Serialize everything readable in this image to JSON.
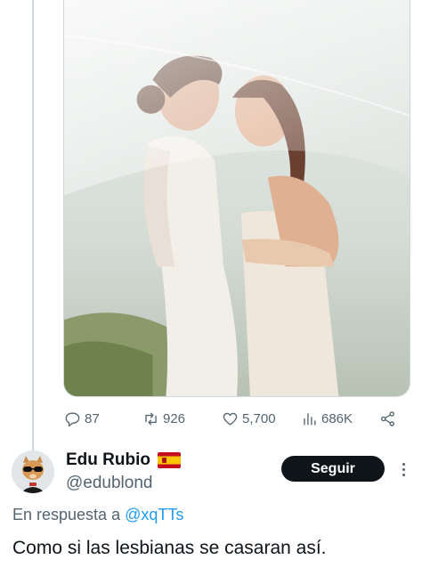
{
  "tweet_actions": {
    "replies": "87",
    "retweets": "926",
    "likes": "5,700",
    "views": "686K"
  },
  "reply": {
    "display_name": "Edu Rubio",
    "handle": "@edublond",
    "follow_label": "Seguir",
    "reply_prefix": "En respuesta a",
    "reply_mention": "@xqTTs",
    "text": "Como si las lesbianas se casaran así."
  },
  "colors": {
    "secondary_text": "#536471",
    "link": "#1d9bf0",
    "button_bg": "#0f1419"
  },
  "icons": [
    "reply-icon",
    "retweet-icon",
    "like-icon",
    "views-icon",
    "share-icon",
    "spain-flag-icon",
    "more-icon"
  ]
}
